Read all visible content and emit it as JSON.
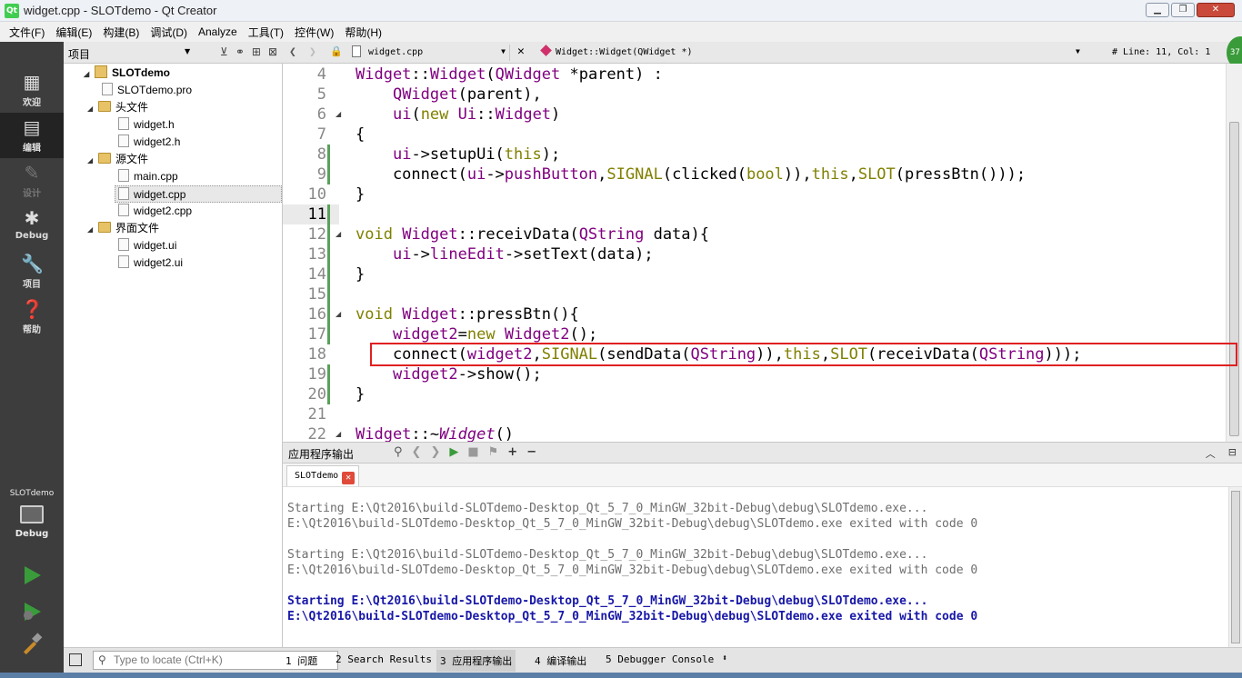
{
  "window": {
    "title": "widget.cpp - SLOTdemo - Qt Creator",
    "app_icon": "Qt"
  },
  "menu": [
    "文件(F)",
    "编辑(E)",
    "构建(B)",
    "调试(D)",
    "Analyze",
    "工具(T)",
    "控件(W)",
    "帮助(H)"
  ],
  "modes": [
    {
      "label": "欢迎",
      "icon": "grid-icon"
    },
    {
      "label": "编辑",
      "icon": "document-icon"
    },
    {
      "label": "设计",
      "icon": "pen-icon"
    },
    {
      "label": "Debug",
      "icon": "bug-icon"
    },
    {
      "label": "项目",
      "icon": "wrench-icon"
    },
    {
      "label": "帮助",
      "icon": "help-icon"
    }
  ],
  "kit": {
    "name": "SLOTdemo",
    "config": "Debug"
  },
  "project_pane": {
    "title": "项目",
    "tree": {
      "root": "SLOTdemo",
      "pro": "SLOTdemo.pro",
      "headers_label": "头文件",
      "headers": [
        "widget.h",
        "widget2.h"
      ],
      "sources_label": "源文件",
      "sources": [
        "main.cpp",
        "widget.cpp",
        "widget2.cpp"
      ],
      "forms_label": "界面文件",
      "forms": [
        "widget.ui",
        "widget2.ui"
      ]
    }
  },
  "editor": {
    "file": "widget.cpp",
    "symbol": "Widget::Widget(QWidget *)",
    "position": "#  Line: 11, Col: 1",
    "current_line": 11
  },
  "output": {
    "pane_title": "应用程序输出",
    "tab": "SLOTdemo",
    "lines": [
      {
        "text": "Starting E:\\Qt2016\\build-SLOTdemo-Desktop_Qt_5_7_0_MinGW_32bit-Debug\\debug\\SLOTdemo.exe...",
        "style": "grey"
      },
      {
        "text": "E:\\Qt2016\\build-SLOTdemo-Desktop_Qt_5_7_0_MinGW_32bit-Debug\\debug\\SLOTdemo.exe exited with code 0",
        "style": "grey"
      },
      {
        "text": "Starting E:\\Qt2016\\build-SLOTdemo-Desktop_Qt_5_7_0_MinGW_32bit-Debug\\debug\\SLOTdemo.exe...",
        "style": "grey"
      },
      {
        "text": "E:\\Qt2016\\build-SLOTdemo-Desktop_Qt_5_7_0_MinGW_32bit-Debug\\debug\\SLOTdemo.exe exited with code 0",
        "style": "grey"
      },
      {
        "text": "Starting E:\\Qt2016\\build-SLOTdemo-Desktop_Qt_5_7_0_MinGW_32bit-Debug\\debug\\SLOTdemo.exe...",
        "style": "blue"
      },
      {
        "text": "E:\\Qt2016\\build-SLOTdemo-Desktop_Qt_5_7_0_MinGW_32bit-Debug\\debug\\SLOTdemo.exe exited with code 0",
        "style": "blue"
      }
    ]
  },
  "status": {
    "locate_placeholder": "Type to locate (Ctrl+K)",
    "tabs": [
      "1 问题",
      "2 Search Results",
      "3 应用程序输出",
      "4 编译输出",
      "5 Debugger Console"
    ]
  },
  "colors": {
    "keyword": "#808000",
    "type": "#800080",
    "highlight_box": "#e02020",
    "run": "#3a9b3a"
  }
}
